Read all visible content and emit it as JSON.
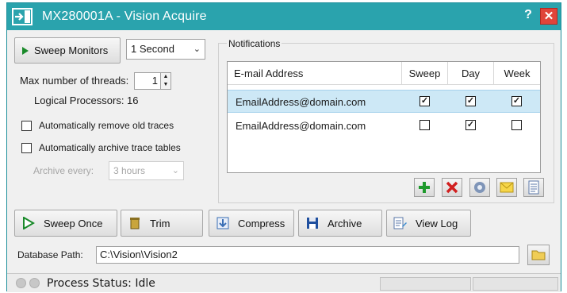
{
  "window": {
    "title": "MX280001A - Vision Acquire",
    "help": "?",
    "close": "✕"
  },
  "controls": {
    "sweep_monitors": "Sweep Monitors",
    "interval": "1 Second",
    "max_threads_label": "Max number of threads:",
    "max_threads_value": "1",
    "logical_processors": "Logical Processors: 16",
    "auto_remove": {
      "label": "Automatically remove old traces",
      "checked": false
    },
    "auto_archive": {
      "label": "Automatically archive trace tables",
      "checked": false
    },
    "archive_every_label": "Archive every:",
    "archive_every_value": "3 hours"
  },
  "notifications": {
    "title": "Notifications",
    "columns": {
      "email": "E-mail Address",
      "sweep": "Sweep",
      "day": "Day",
      "week": "Week"
    },
    "rows": [
      {
        "email": "EmailAddress@domain.com",
        "sweep": true,
        "day": true,
        "week": true,
        "selected": true
      },
      {
        "email": "EmailAddress@domain.com",
        "sweep": false,
        "day": true,
        "week": false,
        "selected": false
      }
    ],
    "toolbar_icons": [
      "add-icon",
      "delete-icon",
      "settings-icon",
      "email-icon",
      "document-icon"
    ]
  },
  "actions": {
    "sweep_once": "Sweep Once",
    "trim": "Trim",
    "compress": "Compress",
    "archive": "Archive",
    "view_log": "View Log"
  },
  "database": {
    "label": "Database Path:",
    "path": "C:\\Vision\\Vision2"
  },
  "status": {
    "text": "Process Status: Idle"
  },
  "colors": {
    "title_bar": "#2aa3ad",
    "close_button": "#e0443a",
    "selection": "#cde8f6",
    "add_green": "#1e9a2c",
    "delete_red": "#d11f1f"
  }
}
